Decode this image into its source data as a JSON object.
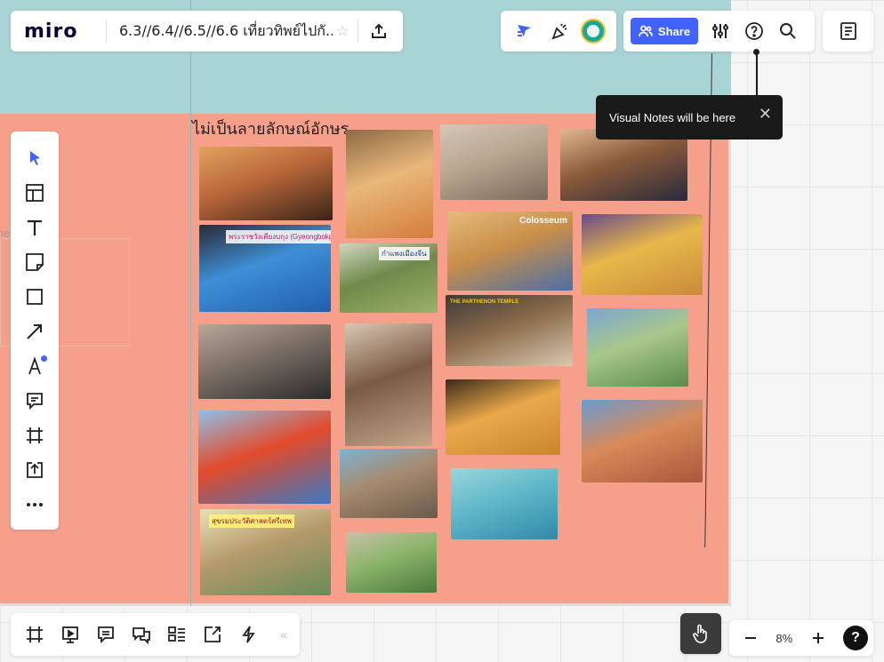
{
  "app": {
    "logo": "miro",
    "board_name": "6.3//6.4//6.5//6.6 เที่ยวทิพย์ไปกั..."
  },
  "topbar": {
    "share_label": "Share"
  },
  "tooltip": {
    "text": "Visual Notes will be here",
    "close": "✕"
  },
  "board": {
    "title": "ไม่เป็นลายลักษณ์อักษร",
    "side_label": "ne"
  },
  "images": [
    {
      "name": "thai-temple-dancers",
      "colors": [
        "#3a2418",
        "#b8663a",
        "#e1a35e"
      ],
      "caption": ""
    },
    {
      "name": "gyeongbokgung-palace",
      "colors": [
        "#1f5fb0",
        "#3e8fd6",
        "#2a2a35"
      ],
      "caption": "พระราชวังเคียงบกุง (Gyeongbokgung Palace) กรุงโซล"
    },
    {
      "name": "street-scene",
      "colors": [
        "#2a2a2a",
        "#7a6e64",
        "#b5a79a"
      ],
      "caption": ""
    },
    {
      "name": "japanese-pagoda",
      "colors": [
        "#3a78c4",
        "#e24a2b",
        "#8fc0e8"
      ],
      "caption": ""
    },
    {
      "name": "thai-prang-ruins",
      "colors": [
        "#6a8a5a",
        "#b59a6a",
        "#e7e2b8"
      ],
      "caption": "สุขรมประวัติศาสตร์ศรีเทพ"
    },
    {
      "name": "egypt-pyramids",
      "colors": [
        "#d47d3a",
        "#e8b87a",
        "#8c6a45"
      ],
      "caption": ""
    },
    {
      "name": "great-wall",
      "colors": [
        "#9bb06b",
        "#6f8a4a",
        "#cfd8c0"
      ],
      "caption": "กำแพงเมืองจีน"
    },
    {
      "name": "european-town",
      "colors": [
        "#c4a68a",
        "#7a5a45",
        "#d9c7b3"
      ],
      "caption": ""
    },
    {
      "name": "ayutthaya-ruins",
      "colors": [
        "#6a5a4a",
        "#a68a6e",
        "#7fb2d6"
      ],
      "caption": ""
    },
    {
      "name": "thai-sanctuary",
      "colors": [
        "#4a7a3a",
        "#8cb46a",
        "#c7c1a9"
      ],
      "caption": ""
    },
    {
      "name": "terracotta-army",
      "colors": [
        "#7a6a5a",
        "#b8a690",
        "#d4c8b8"
      ],
      "caption": ""
    },
    {
      "name": "colosseum",
      "colors": [
        "#4a6fa8",
        "#c98e4a",
        "#e6bb7a"
      ],
      "caption": "Colosseum"
    },
    {
      "name": "parthenon",
      "colors": [
        "#d8c8b0",
        "#8a6a4a",
        "#3a3a3a"
      ],
      "caption": "THE PARTHENON TEMPLE"
    },
    {
      "name": "easter-island-heads",
      "colors": [
        "#c9862a",
        "#e9a84a",
        "#3a2a1a"
      ],
      "caption": ""
    },
    {
      "name": "underwater-mermaid",
      "colors": [
        "#2f8aa8",
        "#5fb8c8",
        "#9ad6dc"
      ],
      "caption": ""
    },
    {
      "name": "japanese-temple",
      "colors": [
        "#2a2a3a",
        "#8a5a3a",
        "#e0b890"
      ],
      "caption": ""
    },
    {
      "name": "golden-pagoda",
      "colors": [
        "#c98a3a",
        "#e8b84a",
        "#6a4a8a"
      ],
      "caption": ""
    },
    {
      "name": "sukhothai-ruins",
      "colors": [
        "#5a8a4a",
        "#a8c88a",
        "#7aa6d4"
      ],
      "caption": ""
    },
    {
      "name": "petra-treasury",
      "colors": [
        "#a8583a",
        "#d88a5a",
        "#6a9ad4"
      ],
      "caption": ""
    }
  ]
}
